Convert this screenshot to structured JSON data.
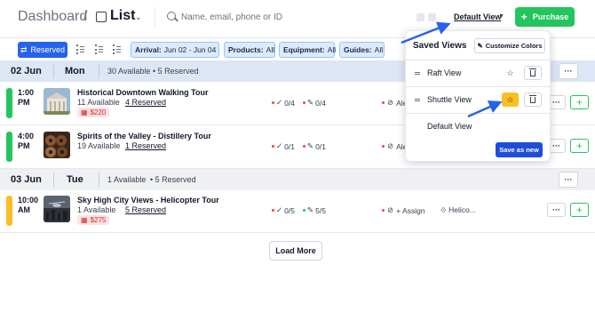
{
  "header": {
    "breadcrumb": "Dashboard",
    "separator": "/",
    "title": "List",
    "search_placeholder": "Name, email, phone or ID",
    "view_selector": "Default View",
    "purchase_label": "Purchase",
    "accent_color": "#22c55e"
  },
  "filters": {
    "reserved_label": "Reserved",
    "chips": [
      {
        "key": "Arrival:",
        "value": "Jun 02 - Jun 04"
      },
      {
        "key": "Products:",
        "value": "All"
      },
      {
        "key": "Equipment:",
        "value": "All"
      },
      {
        "key": "Guides:",
        "value": "All"
      }
    ]
  },
  "days": [
    {
      "date": "02 Jun",
      "dow": "Mon",
      "available": "30 Available",
      "reserved": "5 Reserved",
      "rows": [
        {
          "time": "1:00 PM",
          "name": "Historical Downtown Walking Tour",
          "available": "11 Available",
          "reserved": "4 Reserved",
          "price": "$220",
          "check": "0/4",
          "edit": "0/4",
          "assign": "Ale",
          "status_color": "#22c55e"
        },
        {
          "time": "4:00 PM",
          "name": "Spirits of the Valley - Distillery Tour",
          "available": "19 Available",
          "reserved": "1 Reserved",
          "price": "",
          "check": "0/1",
          "edit": "0/1",
          "assign": "Ale",
          "status_color": "#22c55e"
        }
      ]
    },
    {
      "date": "03 Jun",
      "dow": "Tue",
      "available": "1 Available",
      "reserved": "5 Reserved",
      "rows": [
        {
          "time": "10:00 AM",
          "name": "Sky High City Views - Helicopter Tour",
          "available": "1 Available",
          "reserved": "5 Reserved",
          "price": "$275",
          "check": "0/5",
          "edit": "5/5",
          "assign": "+ Assign",
          "equipment": "Helico...",
          "status_color": "#fbbf24"
        }
      ]
    }
  ],
  "load_more": "Load More",
  "saved_views": {
    "title": "Saved Views",
    "customize_label": "Customize Colors",
    "items": [
      {
        "label": "Raft View",
        "starred": false
      },
      {
        "label": "Shuttle View",
        "starred": true
      },
      {
        "label": "Default View",
        "starred": false
      }
    ],
    "save_as_new": "Save as new"
  }
}
